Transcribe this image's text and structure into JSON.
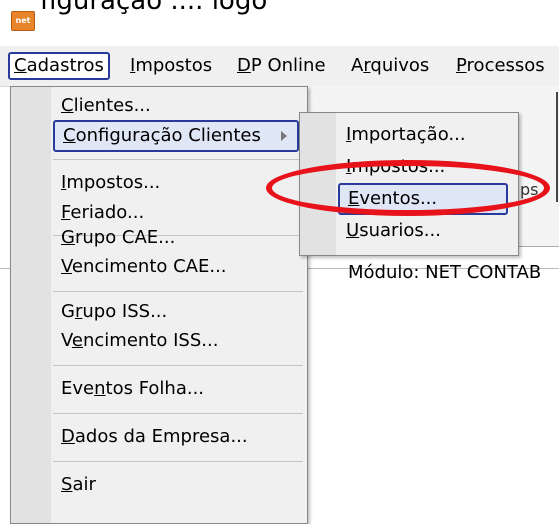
{
  "top_text": "figuraçao ....  logo",
  "menubar": {
    "items": [
      {
        "label": "Cadastros",
        "key": "C",
        "rest": "adastros"
      },
      {
        "label": "Impostos",
        "key": "I",
        "rest": "mpostos"
      },
      {
        "label": "DP Online",
        "key": "D",
        "rest": "P Online"
      },
      {
        "label": "Arquivos",
        "pre": "A",
        "key": "r",
        "rest": "quivos"
      },
      {
        "label": "Processos",
        "key": "P",
        "rest": "rocessos"
      }
    ]
  },
  "cadastros_menu": [
    {
      "pre": "",
      "key": "C",
      "rest": "lientes..."
    },
    {
      "pre": "",
      "key": "C",
      "rest": "onfiguração Clientes"
    },
    {
      "pre": "",
      "key": "I",
      "rest": "mpostos..."
    },
    {
      "pre": "",
      "key": "F",
      "rest": "eriado..."
    },
    {
      "pre": "",
      "key": "G",
      "rest": "rupo CAE..."
    },
    {
      "pre": "",
      "key": "V",
      "rest": "encimento CAE..."
    },
    {
      "pre": "G",
      "key": "r",
      "rest": "upo ISS..."
    },
    {
      "pre": "V",
      "key": "e",
      "rest": "ncimento ISS..."
    },
    {
      "pre": "Eve",
      "key": "n",
      "rest": "tos Folha..."
    },
    {
      "pre": "",
      "key": "D",
      "rest": "ados da Empresa..."
    },
    {
      "pre": "",
      "key": "S",
      "rest": "air"
    }
  ],
  "submenu": [
    {
      "pre": "",
      "key": "I",
      "rest": "mportação..."
    },
    {
      "pre": "",
      "key": "I",
      "rest": "mpostos..."
    },
    {
      "pre": "",
      "key": "E",
      "rest": "ventos..."
    },
    {
      "pre": "",
      "key": "U",
      "rest": "suarios..."
    }
  ],
  "background": {
    "module_label": "Módulo: NET CONTAB",
    "fragment": "ps"
  },
  "colors": {
    "highlight_border": "#2a3a9c",
    "annotation_red": "#e8131a"
  }
}
